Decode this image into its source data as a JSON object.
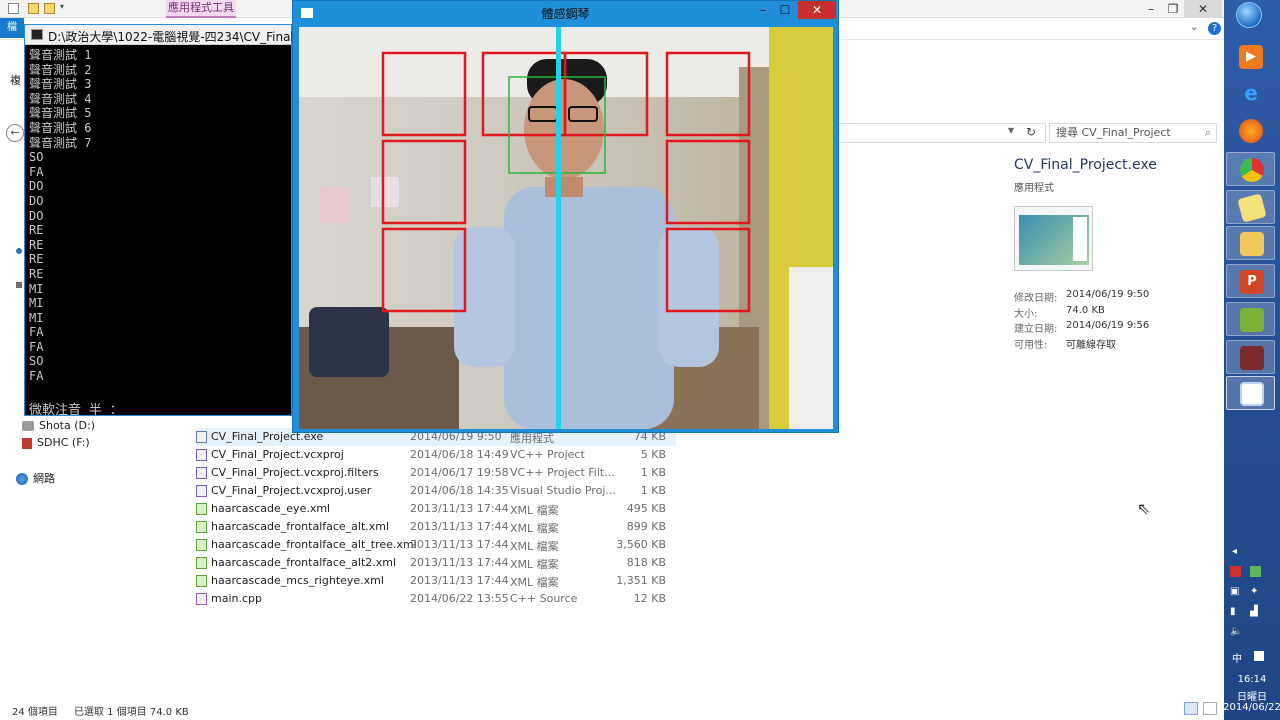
{
  "explorer": {
    "context_tab": "應用程式工具",
    "file_tab": "檔",
    "search_placeholder": "搜尋 CV_Final_Project",
    "nav": [
      {
        "label": "複",
        "top": 0
      },
      {
        "label": "Shota (D:)"
      },
      {
        "label": "SDHC (F:)"
      },
      {
        "label": "網路"
      }
    ],
    "files": [
      {
        "name": "CV_Final_Project.exe",
        "date": "2014/06/19 9:50",
        "type": "應用程式",
        "size": "74 KB",
        "selected": true
      },
      {
        "name": "CV_Final_Project.vcxproj",
        "date": "2014/06/18 14:49",
        "type": "VC++ Project",
        "size": "5 KB"
      },
      {
        "name": "CV_Final_Project.vcxproj.filters",
        "date": "2014/06/17 19:58",
        "type": "VC++ Project Filt...",
        "size": "1 KB"
      },
      {
        "name": "CV_Final_Project.vcxproj.user",
        "date": "2014/06/18 14:35",
        "type": "Visual Studio Proj...",
        "size": "1 KB"
      },
      {
        "name": "haarcascade_eye.xml",
        "date": "2013/11/13 17:44",
        "type": "XML 檔案",
        "size": "495 KB"
      },
      {
        "name": "haarcascade_frontalface_alt.xml",
        "date": "2013/11/13 17:44",
        "type": "XML 檔案",
        "size": "899 KB"
      },
      {
        "name": "haarcascade_frontalface_alt_tree.xml",
        "date": "2013/11/13 17:44",
        "type": "XML 檔案",
        "size": "3,560 KB"
      },
      {
        "name": "haarcascade_frontalface_alt2.xml",
        "date": "2013/11/13 17:44",
        "type": "XML 檔案",
        "size": "818 KB"
      },
      {
        "name": "haarcascade_mcs_righteye.xml",
        "date": "2013/11/13 17:44",
        "type": "XML 檔案",
        "size": "1,351 KB"
      },
      {
        "name": "main.cpp",
        "date": "2014/06/22 13:55",
        "type": "C++ Source",
        "size": "12 KB"
      }
    ],
    "details": {
      "name": "CV_Final_Project.exe",
      "type": "應用程式",
      "rows": [
        {
          "label": "修改日期:",
          "value": "2014/06/19 9:50"
        },
        {
          "label": "大小:",
          "value": "74.0 KB"
        },
        {
          "label": "建立日期:",
          "value": "2014/06/19 9:56"
        },
        {
          "label": "可用性:",
          "value": "可離線存取"
        }
      ]
    },
    "status": {
      "count": "24 個項目",
      "selection": "已選取 1 個項目  74.0 KB"
    }
  },
  "console": {
    "title": "D:\\政治大學\\1022-電腦視覺-四234\\CV_Final_Project\\Debug\\CV_Final_Project.exe",
    "lines": [
      "聲音測試 1",
      "聲音測試 2",
      "聲音測試 3",
      "聲音測試 4",
      "聲音測試 5",
      "聲音測試 6",
      "聲音測試 7",
      "SO",
      "FA",
      "DO",
      "DO",
      "DO",
      "RE",
      "RE",
      "RE",
      "RE",
      "MI",
      "MI",
      "MI",
      "FA",
      "FA",
      "SO",
      "FA"
    ],
    "ime": "微軟注音 半 ："
  },
  "camera": {
    "title": "體感鋼琴"
  },
  "taskbar": {
    "time": "16:14",
    "day": "日曜日",
    "date": "2014/06/22",
    "ime": "中"
  }
}
